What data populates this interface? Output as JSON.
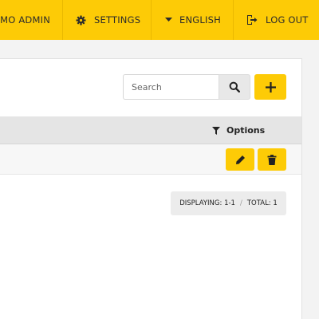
{
  "topbar": {
    "admin_label": "EMO ADMIN",
    "settings_label": "SETTINGS",
    "language_label": "ENGLISH",
    "logout_label": "LOG OUT",
    "background": "#fdcb06"
  },
  "toolbar": {
    "search_placeholder": "Search",
    "search_value": ""
  },
  "table": {
    "options_label": "Options"
  },
  "pager": {
    "displaying": "DISPLAYING: 1-1",
    "separator": "/",
    "total": "TOTAL: 1"
  },
  "icons": {
    "settings": "gear-icon",
    "language": "caret-down-icon",
    "logout": "logout-icon",
    "search": "search-icon",
    "add": "plus-icon",
    "options": "filter-icon",
    "edit": "pencil-icon",
    "delete": "trash-icon"
  },
  "colors": {
    "accent": "#fdcb06",
    "header_row": "#e5e5e5"
  }
}
